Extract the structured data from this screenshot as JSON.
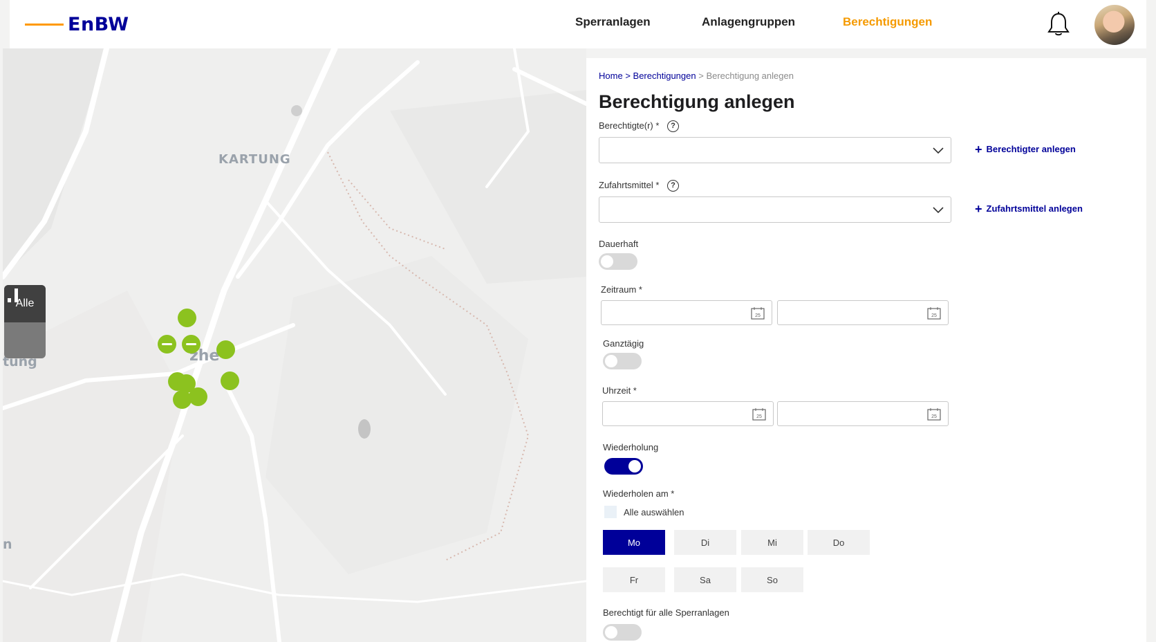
{
  "brand": {
    "name": "EnBW",
    "primary": "#000099",
    "accent": "#ff9900"
  },
  "nav": {
    "items": [
      {
        "label": "Sperranlagen",
        "active": false
      },
      {
        "label": "Anlagengruppen",
        "active": false
      },
      {
        "label": "Berechtigungen",
        "active": true
      }
    ],
    "notification_icon": "bell-icon",
    "avatar_icon": "user-avatar"
  },
  "map": {
    "labels": {
      "town": "KARTUNG",
      "village_partial": "zhe",
      "left_partial": "tung",
      "bottom_partial": "n"
    },
    "filter": {
      "all_label": "Alle",
      "chart_icon": "bar-chart-icon"
    },
    "pin_color": "#8cc21f"
  },
  "breadcrumb": {
    "home": "Home",
    "sep1": ">",
    "section": "Berechtigungen",
    "sep2": ">",
    "current": "Berechtigung anlegen"
  },
  "form": {
    "title": "Berechtigung anlegen",
    "berechtigter": {
      "label": "Berechtigte(r) *",
      "value": "",
      "add_label": "Berechtigter anlegen"
    },
    "zufahrtsmittel": {
      "label": "Zufahrtsmittel *",
      "value": "",
      "add_label": "Zufahrtsmittel anlegen"
    },
    "dauerhaft": {
      "label": "Dauerhaft",
      "on": false
    },
    "zeitraum": {
      "label": "Zeitraum *",
      "from": "",
      "to": "",
      "calendar_day": "25"
    },
    "ganztaegig": {
      "label": "Ganztägig",
      "on": false
    },
    "uhrzeit": {
      "label": "Uhrzeit *",
      "from": "",
      "to": ""
    },
    "wiederholung": {
      "label": "Wiederholung",
      "on": true
    },
    "wiederholen_am": {
      "label": "Wiederholen am *",
      "select_all": "Alle auswählen",
      "days": [
        {
          "label": "Mo",
          "selected": true
        },
        {
          "label": "Di",
          "selected": false
        },
        {
          "label": "Mi",
          "selected": false
        },
        {
          "label": "Do",
          "selected": false
        },
        {
          "label": "Fr",
          "selected": false
        },
        {
          "label": "Sa",
          "selected": false
        },
        {
          "label": "So",
          "selected": false
        }
      ]
    },
    "alle_sperranlagen": {
      "label": "Berechtigt für alle Sperranlagen",
      "on": false
    }
  }
}
